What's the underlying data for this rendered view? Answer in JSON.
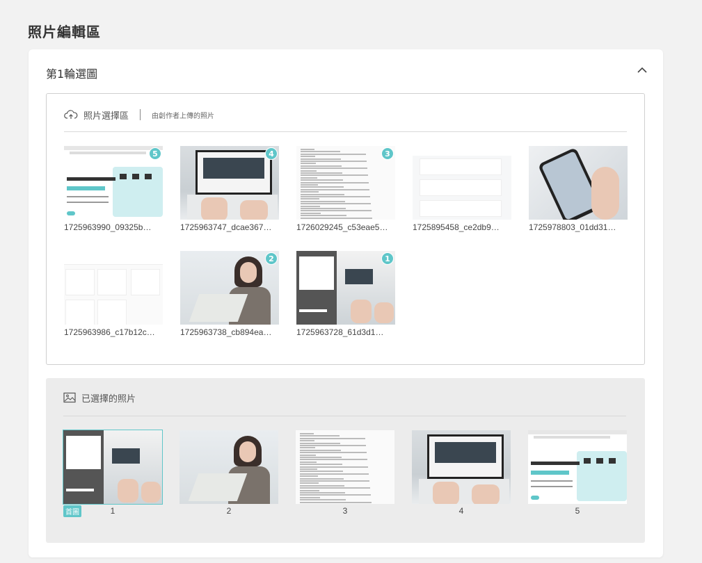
{
  "page_title": "照片編輯區",
  "round": {
    "title": "第1輪選圖",
    "collapse_icon": "chevron-up-icon"
  },
  "selection": {
    "label": "照片選擇區",
    "sublabel": "由創作者上傳的照片",
    "icon": "cloud-upload-icon",
    "photos": [
      {
        "filename": "1725963990_09325b…",
        "badge": "5",
        "kind": "web"
      },
      {
        "filename": "1725963747_dcae367…",
        "badge": "4",
        "kind": "laptop"
      },
      {
        "filename": "1726029245_c53eae5…",
        "badge": "3",
        "kind": "doc"
      },
      {
        "filename": "1725895458_ce2db9…",
        "badge": "",
        "kind": "form"
      },
      {
        "filename": "1725978803_01dd31…",
        "badge": "",
        "kind": "phone"
      },
      {
        "filename": "1725963986_c17b12c…",
        "badge": "",
        "kind": "social"
      },
      {
        "filename": "1725963738_cb894ea…",
        "badge": "2",
        "kind": "woman"
      },
      {
        "filename": "1725963728_61d3d1…",
        "badge": "1",
        "kind": "split"
      }
    ]
  },
  "selected": {
    "label": "已選擇的照片",
    "icon": "image-icon",
    "cover_label": "首圖",
    "photos": [
      {
        "number": "1",
        "kind": "split"
      },
      {
        "number": "2",
        "kind": "woman"
      },
      {
        "number": "3",
        "kind": "doc"
      },
      {
        "number": "4",
        "kind": "laptop"
      },
      {
        "number": "5",
        "kind": "web"
      }
    ]
  },
  "colors": {
    "accent": "#5fc6c9",
    "background": "#f2f2f2",
    "card": "#ffffff"
  }
}
